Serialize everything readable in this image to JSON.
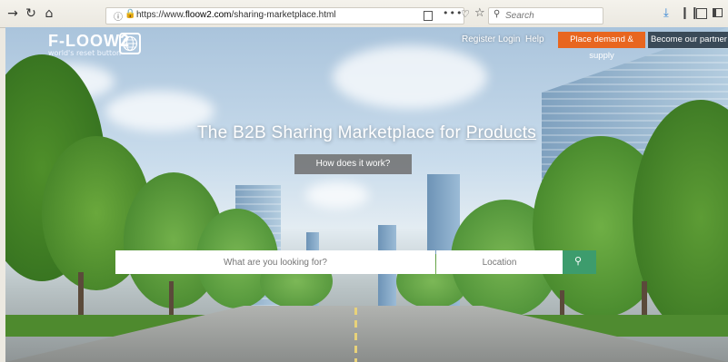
{
  "browser": {
    "url_prefix": "https://www.",
    "url_domain": "floow2.com",
    "url_path": "/sharing-marketplace.html",
    "search_placeholder": "Search",
    "icons": [
      "back-icon",
      "reload-icon",
      "home-icon",
      "info-icon",
      "lock-icon",
      "reader-view-icon",
      "page-actions-icon",
      "pocket-icon",
      "bookmark-star-icon",
      "search-icon",
      "download-icon",
      "library-icon",
      "synced-tabs-icon",
      "sidebar-icon"
    ],
    "page_actions_label": "•••"
  },
  "site": {
    "logo_text": "F-LOOW2",
    "tagline": "world's reset button",
    "nav": {
      "register": "Register",
      "login": "Login",
      "help": "Help",
      "place_demand": "Place demand & supply",
      "become_partner": "Become our partner"
    },
    "hero": {
      "title_prefix": "The B2B Sharing Marketplace for ",
      "title_highlight": "Products",
      "how_button": "How does it work?"
    },
    "search": {
      "what_placeholder": "What are you looking for?",
      "location_placeholder": "Location"
    },
    "colors": {
      "orange_button": "#e8661f",
      "dark_button": "#3a4a58",
      "search_button": "#3d9c6d"
    }
  }
}
